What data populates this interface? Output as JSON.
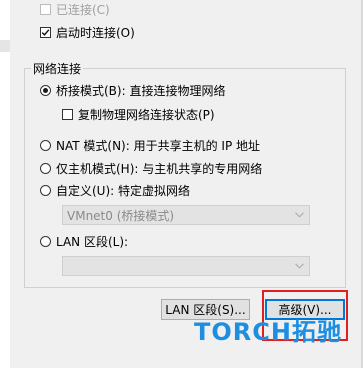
{
  "options": {
    "connected": {
      "label": "已连接(C)",
      "checked": false,
      "enabled": false
    },
    "connect_at_power_on": {
      "label": "启动时连接(O)",
      "checked": true
    }
  },
  "network": {
    "group_title": "网络连接",
    "bridged": {
      "label": "桥接模式(B): 直接连接物理网络",
      "selected": true
    },
    "replicate_state": {
      "label": "复制物理网络连接状态(P)",
      "checked": false
    },
    "nat": {
      "label": "NAT 模式(N): 用于共享主机的 IP 地址",
      "selected": false
    },
    "host_only": {
      "label": "仅主机模式(H): 与主机共享的专用网络",
      "selected": false
    },
    "custom": {
      "label": "自定义(U): 特定虚拟网络",
      "selected": false
    },
    "custom_select": {
      "value": "VMnet0 (桥接模式)"
    },
    "lan_segment": {
      "label": "LAN 区段(L):",
      "selected": false
    },
    "lan_select": {
      "value": ""
    }
  },
  "buttons": {
    "lan_segments": "LAN 区段(S)...",
    "advanced": "高级(V)..."
  },
  "watermark": "TORCH拓驰",
  "colors": {
    "highlight": "#e02020",
    "watermark": "#1e8fe0"
  }
}
